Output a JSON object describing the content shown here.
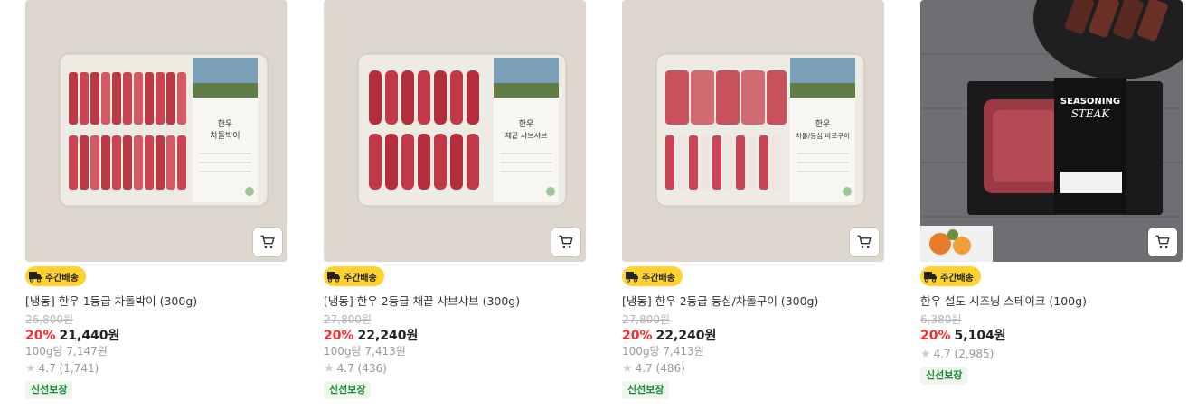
{
  "products": [
    {
      "badge": "주간배송",
      "title": "[냉동] 한우 1등급 차돌박이 (300g)",
      "original_price": "26,800원",
      "discount": "20%",
      "price": "21,440원",
      "unit_price": "100g당 7,147원",
      "rating": "4.7 (1,741)",
      "tag": "신선보장",
      "label_name": "한우\n차돌박이"
    },
    {
      "badge": "주간배송",
      "title": "[냉동] 한우 2등급 채끝 샤브샤브 (300g)",
      "original_price": "27,800원",
      "discount": "20%",
      "price": "22,240원",
      "unit_price": "100g당 7,413원",
      "rating": "4.7 (436)",
      "tag": "신선보장",
      "label_name": "한우\n채끝 샤브샤브"
    },
    {
      "badge": "주간배송",
      "title": "[냉동] 한우 2등급 등심/차돌구이 (300g)",
      "original_price": "27,800원",
      "discount": "20%",
      "price": "22,240원",
      "unit_price": "100g당 7,413원",
      "rating": "4.7 (486)",
      "tag": "신선보장",
      "label_name": "한우\n차돌/등심 바로구이"
    },
    {
      "badge": "주간배송",
      "title": "한우 설도 시즈닝 스테이크 (100g)",
      "original_price": "6,380원",
      "discount": "20%",
      "price": "5,104원",
      "unit_price": "",
      "rating": "4.7 (2,985)",
      "tag": "신선보장",
      "label_name": "SEASONING STEAK"
    }
  ],
  "icons": {
    "cart": "cart-icon",
    "delivery": "delivery-truck-icon",
    "star": "star-icon"
  },
  "colors": {
    "discount": "#fa2828",
    "badge_bg": "#ffd22e",
    "fresh": "#1a8a34"
  }
}
